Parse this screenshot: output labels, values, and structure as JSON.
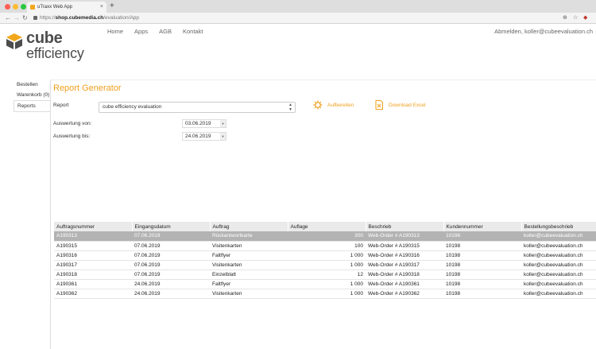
{
  "browser": {
    "tab_title": "uTraxx Web App",
    "url_scheme": "https://",
    "url_host": "shop.cubemedia.ch",
    "url_path": "/evaluation/App"
  },
  "site": {
    "logo_word1": "cube",
    "logo_word2": "efficiency",
    "nav": [
      "Home",
      "Apps",
      "AGB",
      "Kontakt"
    ],
    "user_links": "Abmelden, koller@cubeevaluation.ch",
    "brand_color": "#f0a01e"
  },
  "sidebar": {
    "items": [
      {
        "label": "Bestellen"
      },
      {
        "label": "Warenkorb (0)"
      },
      {
        "label": "Reports",
        "active": true
      }
    ]
  },
  "report": {
    "title": "Report Generator",
    "report_label": "Report",
    "report_value": "cube efficiency evaluation",
    "from_label": "Auswertung von:",
    "from_value": "03.06.2019",
    "to_label": "Auswertung bis:",
    "to_value": "24.06.2019",
    "prepare_label": "Aufbereiten",
    "excel_label": "Download Excel",
    "prepare_icon": "gear-icon",
    "excel_icon": "excel-file-icon"
  },
  "table": {
    "headers": [
      "Auftragsnummer",
      "Eingangsdatum",
      "Auftrag",
      "Auflage",
      "Beschrieb",
      "Kundennummer",
      "Bestellungsbeschrieb"
    ],
    "rows": [
      {
        "nr": "A190313",
        "datum": "07.06.2019",
        "auftrag": "Rückantwortkarte",
        "auflage": "300",
        "beschrieb": "Web-Order # A190313",
        "kunde": "10198",
        "best": "koller@cubeevaluation.ch",
        "selected": true
      },
      {
        "nr": "A190315",
        "datum": "07.06.2019",
        "auftrag": "Visitenkarten",
        "auflage": "100",
        "beschrieb": "Web-Order # A190315",
        "kunde": "10198",
        "best": "koller@cubeevaluation.ch"
      },
      {
        "nr": "A190316",
        "datum": "07.06.2019",
        "auftrag": "Faltflyer",
        "auflage": "1 000",
        "beschrieb": "Web-Order # A190316",
        "kunde": "10198",
        "best": "koller@cubeevaluation.ch"
      },
      {
        "nr": "A190317",
        "datum": "07.06.2019",
        "auftrag": "Visitenkarten",
        "auflage": "1 000",
        "beschrieb": "Web-Order # A190317",
        "kunde": "10198",
        "best": "koller@cubeevaluation.ch"
      },
      {
        "nr": "A190318",
        "datum": "07.06.2019",
        "auftrag": "Einzelblatt",
        "auflage": "12",
        "beschrieb": "Web-Order # A190318",
        "kunde": "10198",
        "best": "koller@cubeevaluation.ch"
      },
      {
        "nr": "A190361",
        "datum": "24.06.2019",
        "auftrag": "Faltflyer",
        "auflage": "1 000",
        "beschrieb": "Web-Order # A190361",
        "kunde": "10198",
        "best": "koller@cubeevaluation.ch"
      },
      {
        "nr": "A190362",
        "datum": "24.06.2019",
        "auftrag": "Visitenkarten",
        "auflage": "1 000",
        "beschrieb": "Web-Order # A190362",
        "kunde": "10198",
        "best": "koller@cubeevaluation.ch"
      }
    ]
  }
}
